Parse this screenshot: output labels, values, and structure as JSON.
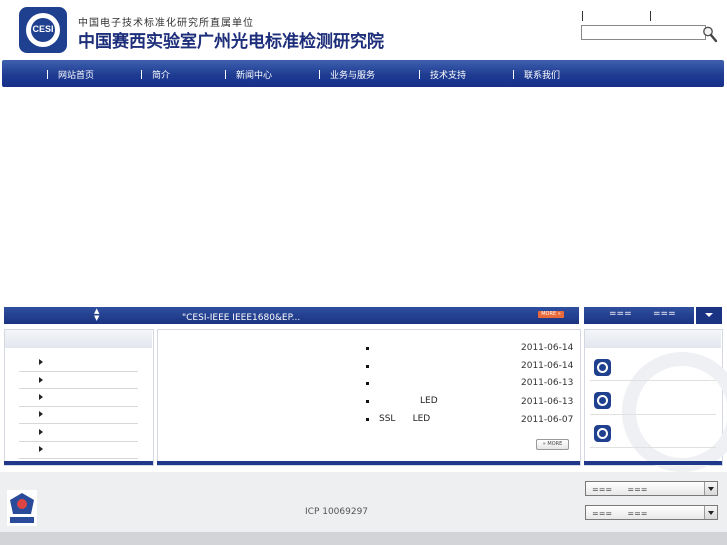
{
  "header": {
    "subtitle": "中国电子技术标准化研究所直属单位",
    "title": "中国赛西实验室广州光电标准检测研究院",
    "logo_text": "CESI",
    "search_placeholder": ""
  },
  "nav": {
    "items": [
      {
        "label": "网站首页"
      },
      {
        "label": "简介"
      },
      {
        "label": "新闻中心"
      },
      {
        "label": "业务与服务"
      },
      {
        "label": "技术支持"
      },
      {
        "label": "联系我们"
      }
    ]
  },
  "ticker": {
    "text": "\"CESI-IEEE          IEEE1680&EP...",
    "more_label": "MORE »"
  },
  "news": {
    "items": [
      {
        "title": "",
        "date": "2011-06-14"
      },
      {
        "title": "",
        "date": "2011-06-14"
      },
      {
        "title": "",
        "date": "2011-06-13"
      },
      {
        "title": "LED",
        "date": "2011-06-13"
      },
      {
        "title": "SSL      LED",
        "date": "2011-06-07"
      }
    ],
    "more_label": "» MORE"
  },
  "right_tabs": {
    "tab1": "===",
    "tab2": "==="
  },
  "left_list": {
    "items": [
      {
        "label": ""
      },
      {
        "label": ""
      },
      {
        "label": ""
      },
      {
        "label": ""
      },
      {
        "label": ""
      },
      {
        "label": ""
      }
    ]
  },
  "footer": {
    "icp": "ICP 10069297",
    "select1": "===      ===",
    "select2": "===      ==="
  },
  "colors": {
    "nav_blue": "#1f3c92",
    "brand_blue": "#1d2e7a",
    "accent_orange": "#e86a3a"
  }
}
